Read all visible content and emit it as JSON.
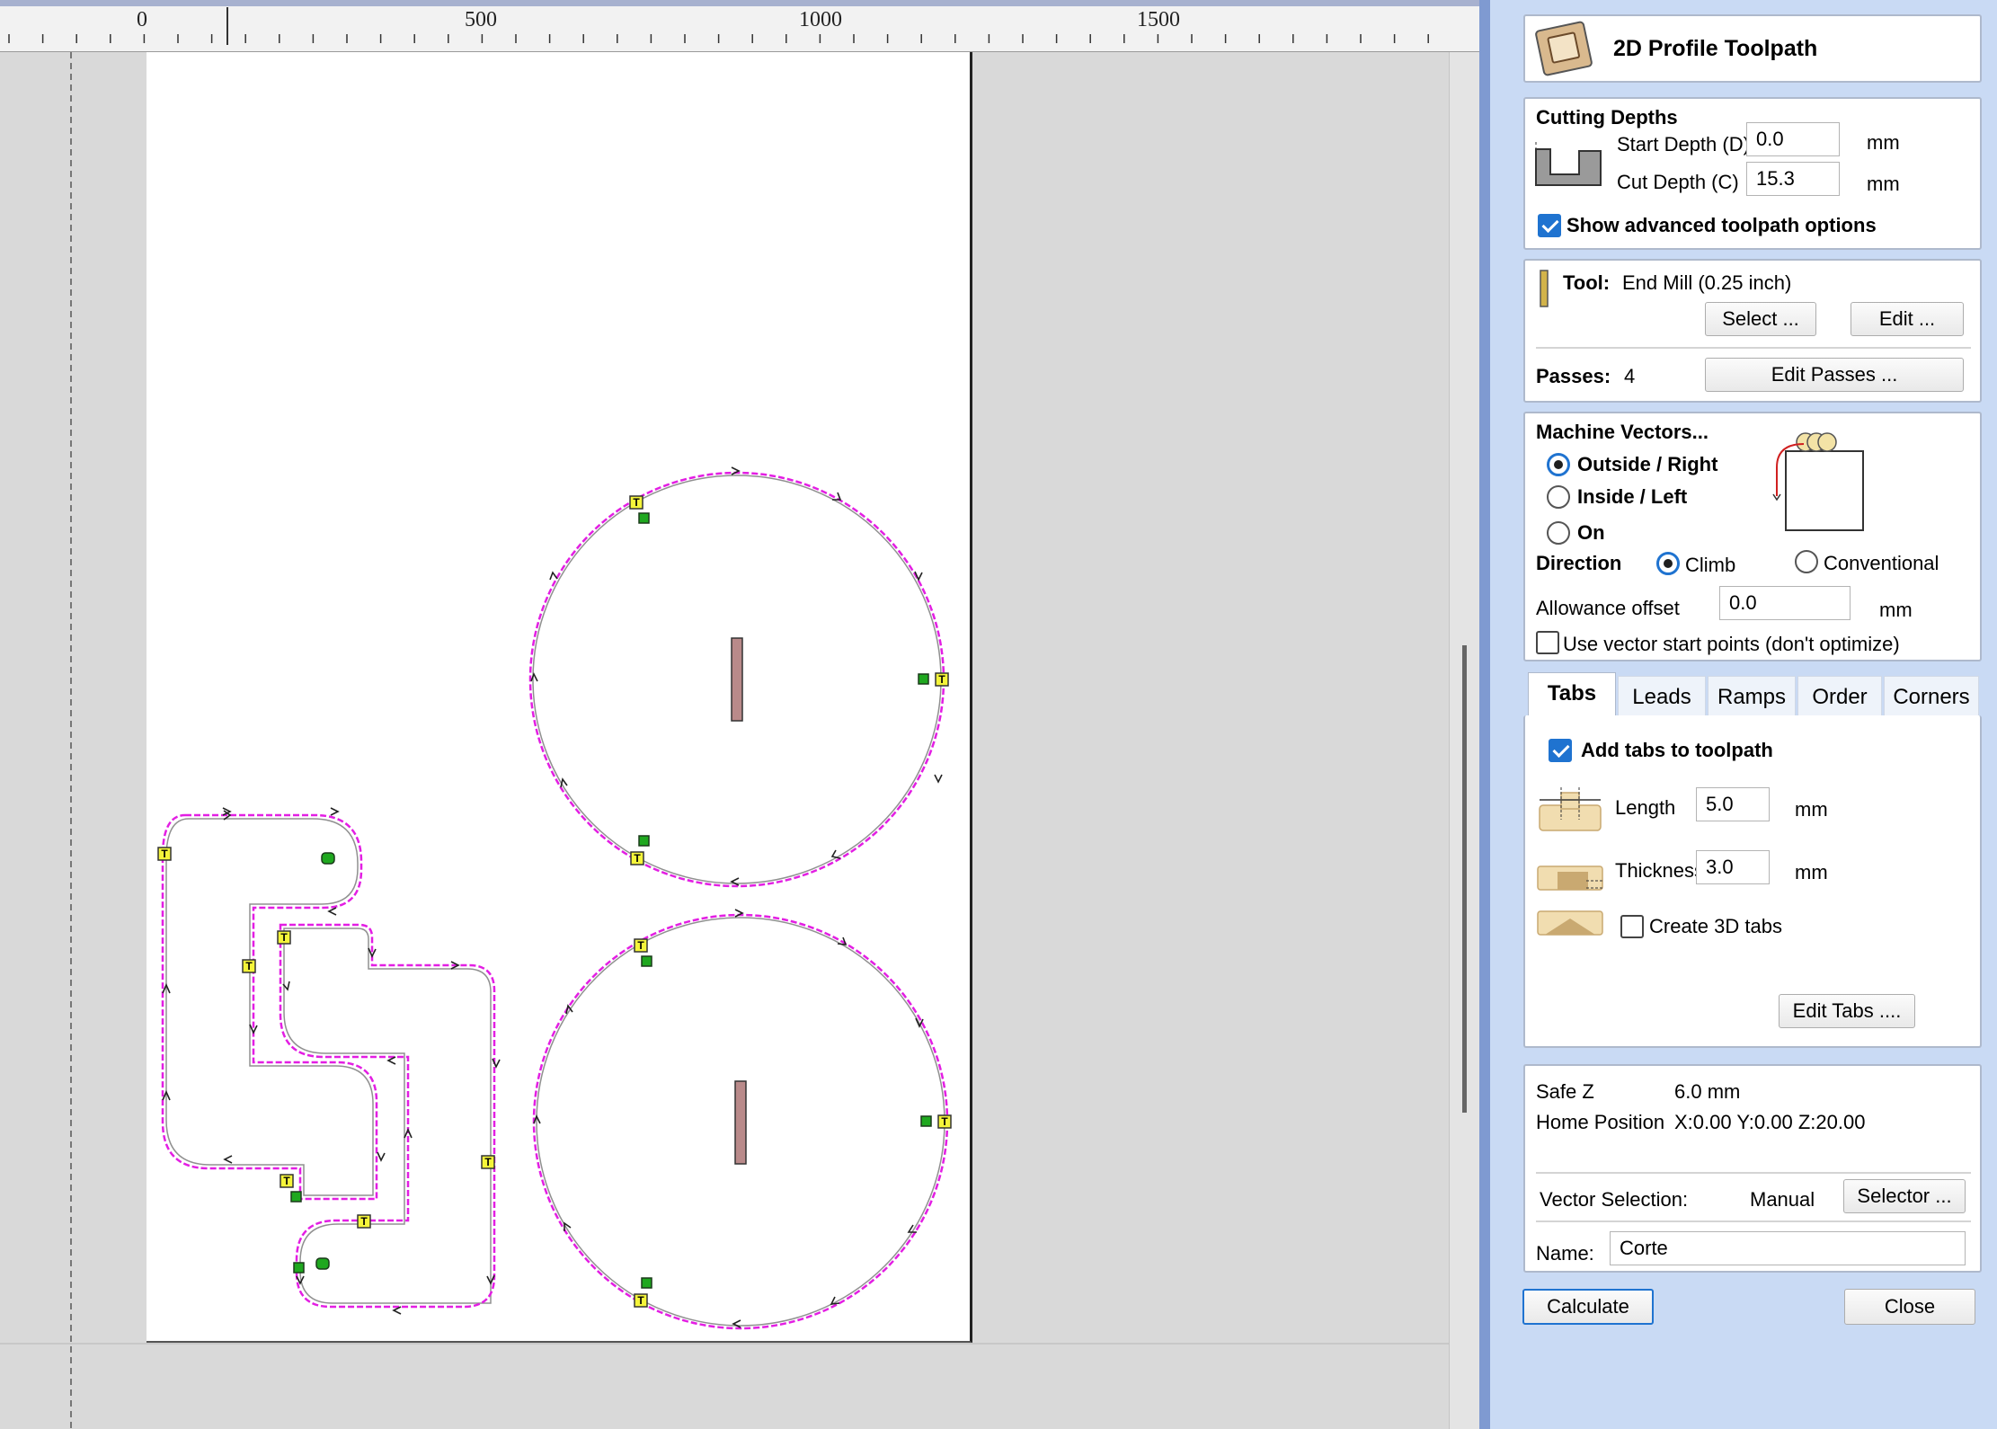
{
  "ruler": {
    "labels": [
      "0",
      "500",
      "1000",
      "1500"
    ]
  },
  "panel": {
    "title": "2D Profile Toolpath",
    "cutting_depths": {
      "heading": "Cutting Depths",
      "start_label": "Start Depth (D)",
      "start_value": "0.0",
      "cut_label": "Cut Depth (C)",
      "cut_value": "15.3",
      "unit": "mm",
      "advanced_label": "Show advanced toolpath options",
      "advanced_checked": true
    },
    "tool": {
      "label": "Tool:",
      "value": "End Mill (0.25 inch)",
      "select_label": "Select ...",
      "edit_label": "Edit ...",
      "passes_label": "Passes:",
      "passes_value": "4",
      "edit_passes_label": "Edit Passes ..."
    },
    "machine_vectors": {
      "heading": "Machine Vectors...",
      "outside_label": "Outside / Right",
      "inside_label": "Inside / Left",
      "on_label": "On",
      "selected": "outside",
      "direction_label": "Direction",
      "climb_label": "Climb",
      "conventional_label": "Conventional",
      "direction_selected": "climb",
      "allowance_label": "Allowance offset",
      "allowance_value": "0.0",
      "unit": "mm",
      "start_points_label": "Use vector start points (don't optimize)",
      "start_points_checked": false
    },
    "tabs_bar": [
      "Tabs",
      "Leads",
      "Ramps",
      "Order",
      "Corners"
    ],
    "active_tab": "Tabs",
    "tabs_panel": {
      "add_tabs_label": "Add tabs to toolpath",
      "add_tabs_checked": true,
      "length_label": "Length",
      "length_value": "5.0",
      "thickness_label": "Thickness",
      "thickness_value": "3.0",
      "unit": "mm",
      "create_3d_label": "Create 3D tabs",
      "create_3d_checked": false,
      "edit_tabs_label": "Edit Tabs ...."
    },
    "info": {
      "safe_z_label": "Safe Z",
      "safe_z_value": "6.0 mm",
      "home_label": "Home Position",
      "home_value": "X:0.00 Y:0.00 Z:20.00",
      "vector_selection_label": "Vector Selection:",
      "vector_selection_value": "Manual",
      "selector_label": "Selector ...",
      "name_label": "Name:",
      "name_value": "Corte"
    },
    "calculate_label": "Calculate",
    "close_label": "Close"
  },
  "colors": {
    "toolpath": "#e31ee3",
    "vector": "#8a8a8a",
    "tab_marker": "#f5f53a",
    "start_marker": "#1fa81f",
    "accent": "#1f73d0",
    "panel_bg": "#c9daf4"
  }
}
